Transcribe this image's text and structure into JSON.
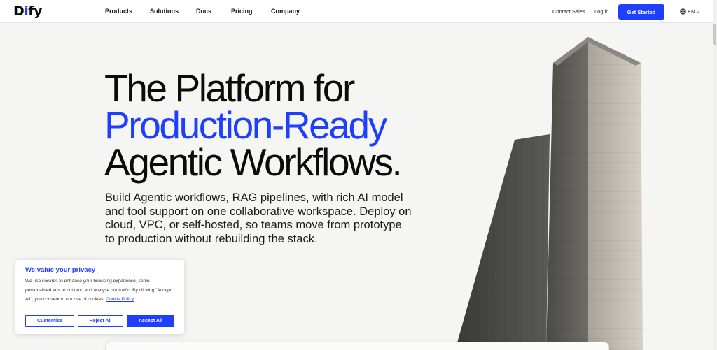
{
  "brand": {
    "logo_text": "Dify",
    "accent": "#1f3fff"
  },
  "nav": {
    "links": [
      "Products",
      "Solutions",
      "Docs",
      "Pricing",
      "Company"
    ],
    "contact_sales": "Contact Sales",
    "login": "Log in",
    "cta": "Get Started",
    "language": "EN",
    "icons": {
      "language": "globe-icon",
      "dropdown": "chevron-down-icon"
    }
  },
  "hero": {
    "headline_line1": "The Platform for",
    "headline_line2": "Production-Ready",
    "headline_line3": "Agentic Workflows.",
    "subtext": "Build Agentic workflows, RAG pipelines, with rich AI model and tool support on one collaborative workspace. Deploy on cloud, VPC, or self-hosted, so teams move from prototype to production without rebuilding the stack."
  },
  "cookie_banner": {
    "title": "We value your privacy",
    "body": "We use cookies to enhance your browsing experience, serve personalised ads or content, and analyse our traffic. By clicking \"Accept All\", you consent to our use of cookies.",
    "policy_link": "Cookie Policy",
    "customise": "Customise",
    "reject_all": "Reject All",
    "accept_all": "Accept All"
  }
}
